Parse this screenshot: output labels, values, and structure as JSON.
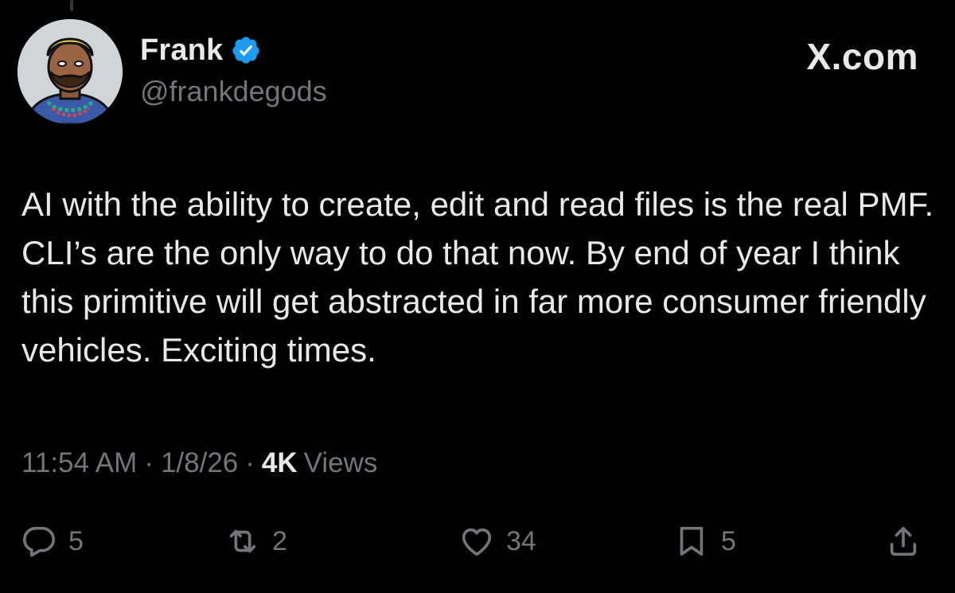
{
  "author": {
    "display_name": "Frank",
    "handle": "@frankdegods",
    "verified": true,
    "avatar_icon": "cartoon-avatar-icon"
  },
  "brand": {
    "label": "X.com"
  },
  "tweet": {
    "text": "AI with the ability to create, edit and read files is the real PMF. CLI’s are the only way to do that now. By end of year I think this primitive will get abstracted in far more consumer friendly vehicles. Exciting times."
  },
  "meta": {
    "time": "11:54 AM",
    "separator": "·",
    "date": "1/8/26",
    "views_count": "4K",
    "views_label": "Views"
  },
  "actions": {
    "reply": {
      "icon": "reply-icon",
      "count": "5"
    },
    "repost": {
      "icon": "repost-icon",
      "count": "2"
    },
    "like": {
      "icon": "heart-icon",
      "count": "34"
    },
    "bookmark": {
      "icon": "bookmark-icon",
      "count": "5"
    },
    "share": {
      "icon": "share-icon"
    }
  },
  "colors": {
    "background": "#000000",
    "primary_text": "#e7e9ea",
    "secondary_text": "#71767b",
    "verified_badge": "#1d9bf0"
  }
}
